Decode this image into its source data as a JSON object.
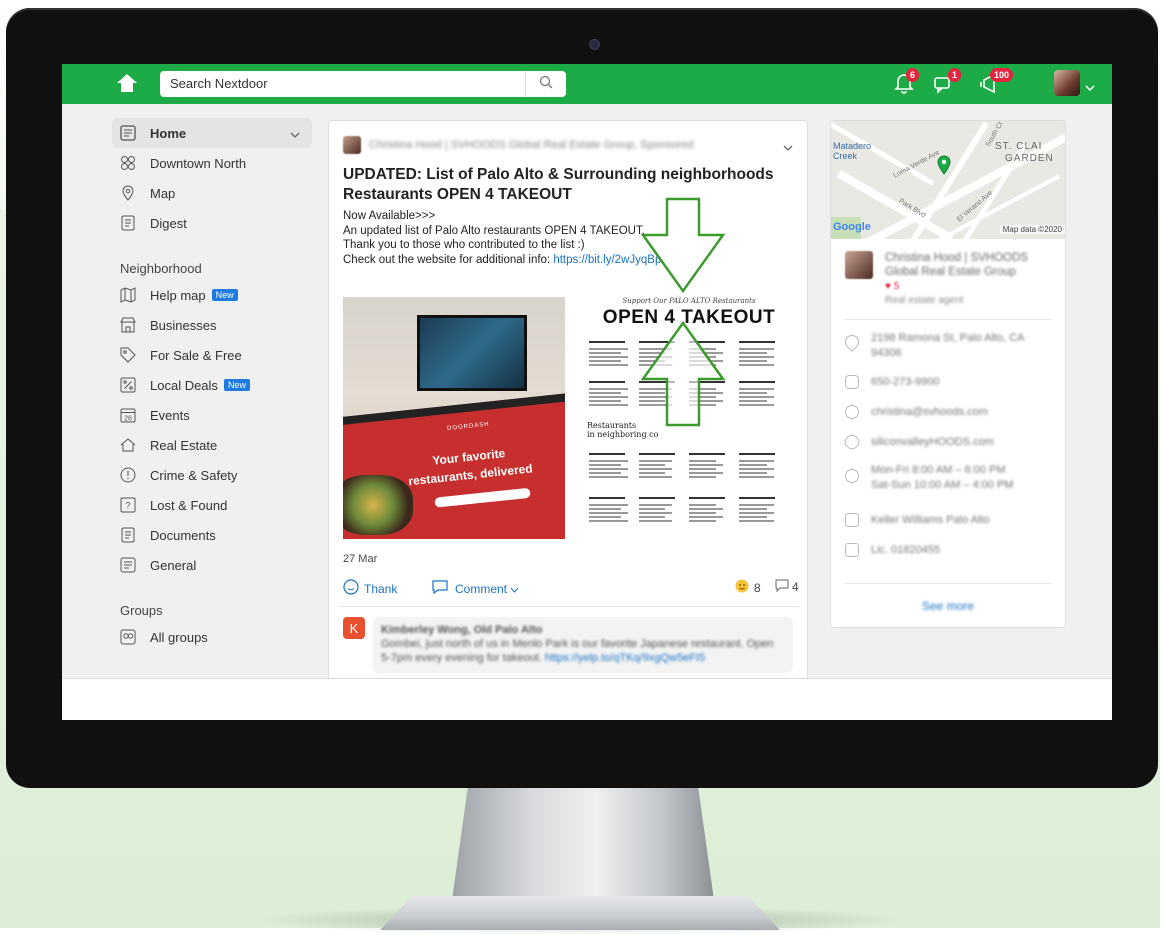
{
  "topbar": {
    "search_placeholder": "Search Nextdoor",
    "notifications_count": "6",
    "messages_count": "1",
    "activity_count": "100",
    "brand_color": "#1cab47"
  },
  "sidebar": {
    "items": [
      {
        "label": "Home",
        "icon": "newsfeed-icon"
      },
      {
        "label": "Downtown North",
        "icon": "neighbors-icon"
      },
      {
        "label": "Map",
        "icon": "map-pin-icon"
      },
      {
        "label": "Digest",
        "icon": "document-icon"
      }
    ],
    "neighborhood_heading": "Neighborhood",
    "neighborhood_items": [
      {
        "label": "Help map",
        "icon": "map-icon",
        "tag": "New"
      },
      {
        "label": "Businesses",
        "icon": "storefront-icon"
      },
      {
        "label": "For Sale & Free",
        "icon": "tag-icon"
      },
      {
        "label": "Local Deals",
        "icon": "percent-icon",
        "tag": "New"
      },
      {
        "label": "Events",
        "icon": "calendar-icon",
        "day": "26"
      },
      {
        "label": "Real Estate",
        "icon": "house-icon"
      },
      {
        "label": "Crime & Safety",
        "icon": "alert-icon"
      },
      {
        "label": "Lost & Found",
        "icon": "question-icon"
      },
      {
        "label": "Documents",
        "icon": "document-icon"
      },
      {
        "label": "General",
        "icon": "newsfeed-icon"
      }
    ],
    "groups_heading": "Groups",
    "groups_items": [
      {
        "label": "All groups",
        "icon": "groups-icon"
      }
    ]
  },
  "post": {
    "author": "Christina Hood | SVHOODS Global Real Estate Group, Sponsored",
    "title": "UPDATED: List of Palo Alto & Surrounding neighborhoods Restaurants OPEN 4 TAKEOUT",
    "body_lines": [
      "Now Available>>>",
      "An updated list of Palo Alto restaurants OPEN 4 TAKEOUT.",
      "Thank you to those who contributed to the list :)"
    ],
    "body_link_prefix": "Check out the website for additional info: ",
    "body_link": "https://bit.ly/2wJyqBp",
    "image1": {
      "brand": "DOORDASH",
      "line1": "Your favorite",
      "line2": "restaurants, delivered"
    },
    "image2": {
      "support_line": "Support Our PALO ALTO Restaurants",
      "headline": "OPEN 4 TAKEOUT",
      "sub_heading_1": "Restaurants",
      "sub_heading_2": "in neighboring co"
    },
    "date": "27 Mar",
    "thank_label": "Thank",
    "comment_label": "Comment",
    "reactions_count": "8",
    "comments_count": "4"
  },
  "comment": {
    "avatar_letter": "K",
    "author": "Kimberley Wong, Old Palo Alto",
    "text": "Gombei, just north of us in Menlo Park is our favorite Japanese restaurant. Open 5-7pm every evening for takeout.",
    "link": "https://yelp.to/qTKq/9xgQw5eFI5"
  },
  "business": {
    "map_labels": {
      "matadero": "Matadero",
      "creek": "Creek",
      "st_clair": "ST. CLAI",
      "garden": "GARDEN",
      "google": "Google",
      "map_data": "Map data ©2020",
      "street1": "Loma Verde Ave",
      "street2": "South Ct",
      "street3": "Park Blvd",
      "street4": "El Verano Ave"
    },
    "name": "Christina Hood | SVHOODS Global Real Estate Group",
    "hearts": "5",
    "category": "Real estate agent",
    "address": "2198 Ramona St, Palo Alto, CA 94306",
    "phone": "650-273-9900",
    "email": "christina@svhoods.com",
    "website": "siliconvalleyHOODS.com",
    "hours_1": "Mon-Fri 8:00 AM – 6:00 PM",
    "hours_2": "Sat-Sun 10:00 AM – 4:00 PM",
    "brokerage": "Keller Williams Palo Alto",
    "license": "Lic. 01820455",
    "see_more": "See more"
  }
}
